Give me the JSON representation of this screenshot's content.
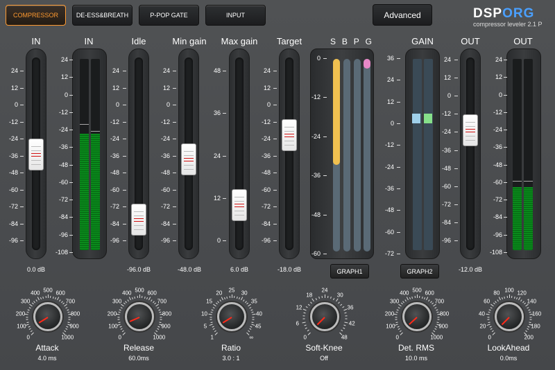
{
  "tabs": [
    {
      "label": "COMPRESSOR",
      "active": true
    },
    {
      "label": "DE-ESS&BREATH",
      "active": false
    },
    {
      "label": "P-POP  GATE",
      "active": false
    },
    {
      "label": "INPUT",
      "active": false
    }
  ],
  "advanced_label": "Advanced",
  "logo": {
    "brand_a": "DSP",
    "brand_b": "ORG",
    "subtitle": "compressor leveler 2.1 P"
  },
  "scales": {
    "in": [
      "24",
      "12",
      "0",
      "-12",
      "-24",
      "-36",
      "-48",
      "-60",
      "-72",
      "-84",
      "-96"
    ],
    "meter": [
      "24",
      "12",
      "0",
      "-12",
      "-24",
      "-36",
      "-48",
      "-60",
      "-72",
      "-84",
      "-96",
      "-108"
    ],
    "maxgain": [
      "48",
      "36",
      "24",
      "12",
      "0"
    ],
    "sbpg": [
      "0",
      "-12",
      "-24",
      "-36",
      "-48",
      "-60"
    ],
    "gain": [
      "36",
      "24",
      "12",
      "0",
      "-12",
      "-24",
      "-36",
      "-48",
      "-60",
      "-72"
    ]
  },
  "sliders": [
    {
      "title": "IN",
      "value": "0.0 dB",
      "level": 0.5
    },
    {
      "title": "Idle",
      "value": "-96.0 dB",
      "level": 0.9
    },
    {
      "title": "Min gain",
      "value": "-48.0 dB",
      "level": 0.53
    },
    {
      "title": "Max gain",
      "value": "6.0 dB",
      "level": 0.81
    },
    {
      "title": "Target",
      "value": "-18.0 dB",
      "level": 0.38
    },
    {
      "title": "OUT",
      "value": "-12.0 dB",
      "level": 0.35
    }
  ],
  "meters": [
    {
      "title": "IN",
      "level": 0.61
    },
    {
      "title": "OUT",
      "level": 0.33
    }
  ],
  "sbpg": {
    "letters": [
      "S",
      "B",
      "P",
      "G"
    ],
    "colors": [
      "#f0c050",
      "#5a6a76",
      "#5a6a76",
      "#e888c8"
    ],
    "levels": [
      0.55,
      0,
      0,
      0.05
    ]
  },
  "gain": {
    "title": "GAIN"
  },
  "buttons": {
    "graph1": "GRAPH1",
    "graph2": "GRAPH2"
  },
  "knobs": [
    {
      "name": "Attack",
      "value": "4.0 ms",
      "labels": [
        "0",
        "100",
        "200",
        "300",
        "400",
        "500",
        "600",
        "700",
        "800",
        "900",
        "1000"
      ],
      "level": 0.05
    },
    {
      "name": "Release",
      "value": "60.0ms",
      "labels": [
        "0",
        "100",
        "200",
        "300",
        "400",
        "500",
        "600",
        "700",
        "800",
        "900",
        "1000"
      ],
      "level": 0.08
    },
    {
      "name": "Ratio",
      "value": "3.0 : 1",
      "labels": [
        "1",
        "5",
        "10",
        "15",
        "20",
        "25",
        "30",
        "35",
        "40",
        "45",
        "∞"
      ],
      "level": 0.05
    },
    {
      "name": "Soft-Knee",
      "value": "Off",
      "labels": [
        "0",
        "6",
        "12",
        "18",
        "24",
        "30",
        "36",
        "42",
        "48"
      ],
      "level": 0.0
    },
    {
      "name": "Det. RMS",
      "value": "10.0 ms",
      "labels": [
        "0",
        "100",
        "200",
        "300",
        "400",
        "500",
        "600",
        "700",
        "800",
        "900",
        "1000"
      ],
      "level": 0.01
    },
    {
      "name": "LookAhead",
      "value": "0.0ms",
      "labels": [
        "0",
        "20",
        "40",
        "60",
        "80",
        "100",
        "120",
        "140",
        "160",
        "180",
        "200"
      ],
      "level": 0.0
    }
  ]
}
